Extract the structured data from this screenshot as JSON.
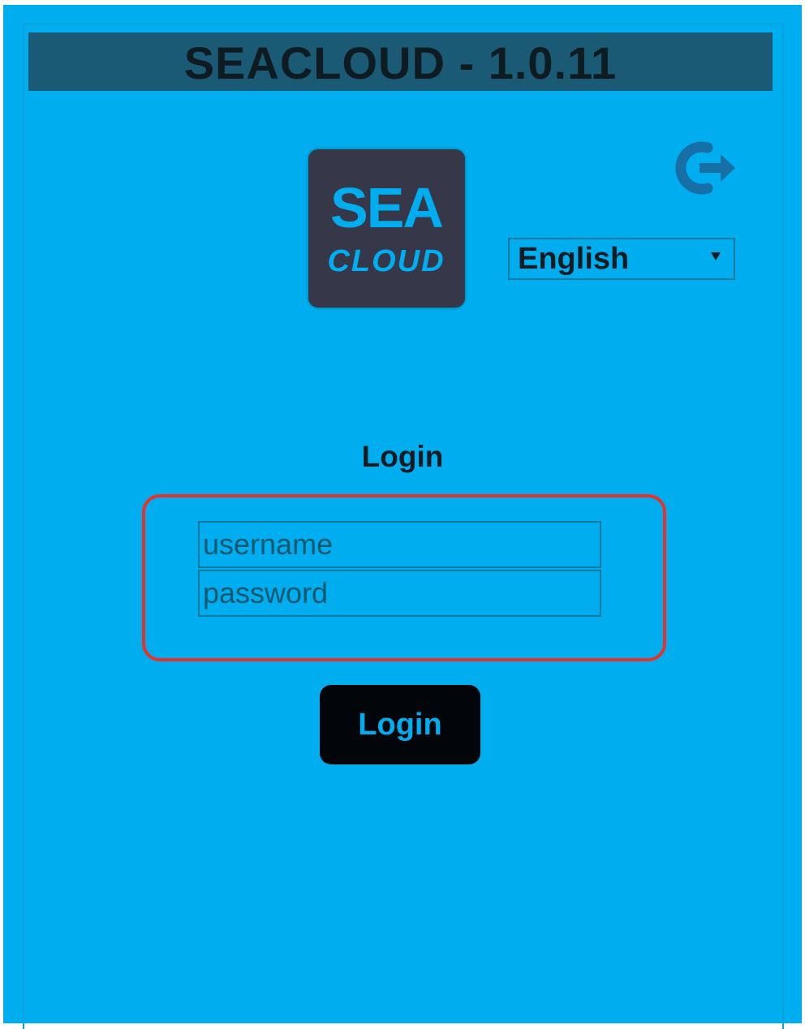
{
  "app": {
    "title": "SEACLOUD - 1.0.11"
  },
  "logo": {
    "line1": "SEA",
    "line2": "CLOUD"
  },
  "header": {
    "logout_icon": "logout-icon"
  },
  "language": {
    "selected": "English"
  },
  "login": {
    "heading": "Login",
    "username_placeholder": "username",
    "password_placeholder": "password",
    "button_label": "Login"
  },
  "colors": {
    "background": "#00aeef",
    "title_bar": "#1a5a75",
    "button": "#02050a",
    "highlight": "#e8312a"
  }
}
